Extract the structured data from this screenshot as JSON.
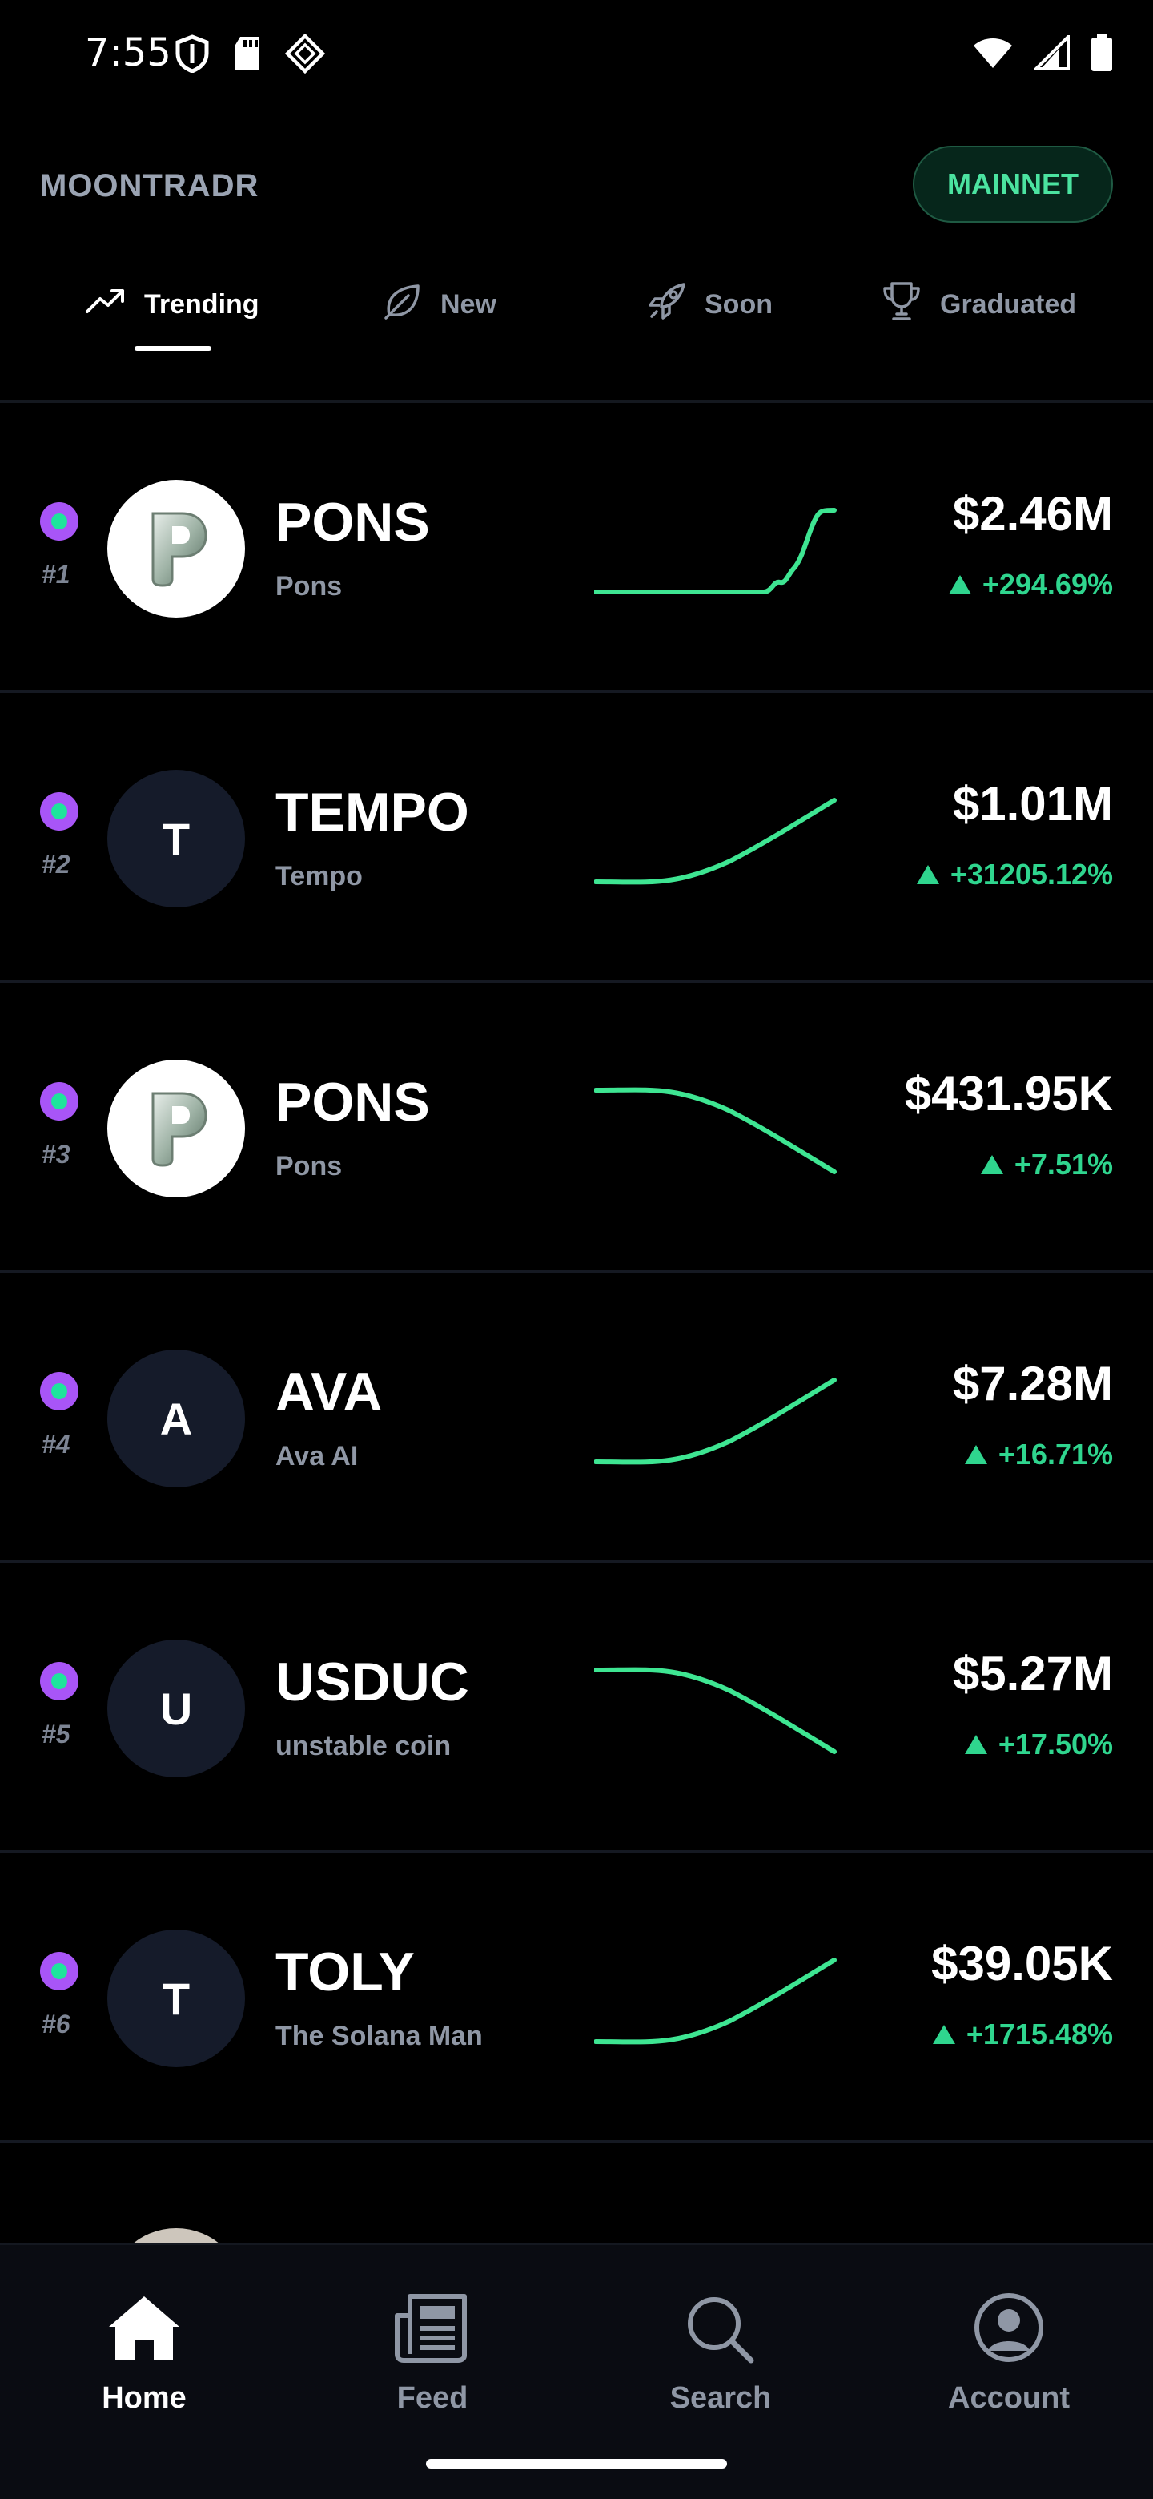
{
  "status": {
    "time": "7:55",
    "left_icons": [
      "shield-icon",
      "sd-card-icon",
      "diamond-app-icon"
    ],
    "right_icons": [
      "wifi-icon",
      "signal-icon",
      "battery-icon"
    ]
  },
  "header": {
    "title": "MOONTRADR",
    "network_badge": "MAINNET"
  },
  "tabs": [
    {
      "label": "Trending",
      "icon": "trending-icon",
      "active": true
    },
    {
      "label": "New",
      "icon": "leaf-icon",
      "active": false
    },
    {
      "label": "Soon",
      "icon": "rocket-icon",
      "active": false
    },
    {
      "label": "Graduated",
      "icon": "trophy-icon",
      "active": false
    }
  ],
  "tokens": [
    {
      "rank": "#1",
      "symbol": "PONS",
      "name": "Pons",
      "avatar": "P",
      "avatar_type": "image",
      "price": "$2.46M",
      "change": "+294.69%",
      "trend": "spike-up"
    },
    {
      "rank": "#2",
      "symbol": "TEMPO",
      "name": "Tempo",
      "avatar": "T",
      "avatar_type": "letter",
      "price": "$1.01M",
      "change": "+31205.12%",
      "trend": "up"
    },
    {
      "rank": "#3",
      "symbol": "PONS",
      "name": "Pons",
      "avatar": "P",
      "avatar_type": "image",
      "price": "$431.95K",
      "change": "+7.51%",
      "trend": "down"
    },
    {
      "rank": "#4",
      "symbol": "AVA",
      "name": "Ava AI",
      "avatar": "A",
      "avatar_type": "letter",
      "price": "$7.28M",
      "change": "+16.71%",
      "trend": "up"
    },
    {
      "rank": "#5",
      "symbol": "USDUC",
      "name": "unstable coin",
      "avatar": "U",
      "avatar_type": "letter",
      "price": "$5.27M",
      "change": "+17.50%",
      "trend": "down"
    },
    {
      "rank": "#6",
      "symbol": "TOLY",
      "name": "The Solana Man",
      "avatar": "T",
      "avatar_type": "letter",
      "price": "$39.05K",
      "change": "+1715.48%",
      "trend": "up"
    }
  ],
  "nav": [
    {
      "label": "Home",
      "icon": "home-icon",
      "active": true
    },
    {
      "label": "Feed",
      "icon": "feed-icon",
      "active": false
    },
    {
      "label": "Search",
      "icon": "search-icon",
      "active": false
    },
    {
      "label": "Account",
      "icon": "account-icon",
      "active": false
    }
  ],
  "colors": {
    "background": "#000000",
    "accent_green": "#2fd58e",
    "live_dot": "#a855f7",
    "muted_text": "#8f97a5"
  }
}
